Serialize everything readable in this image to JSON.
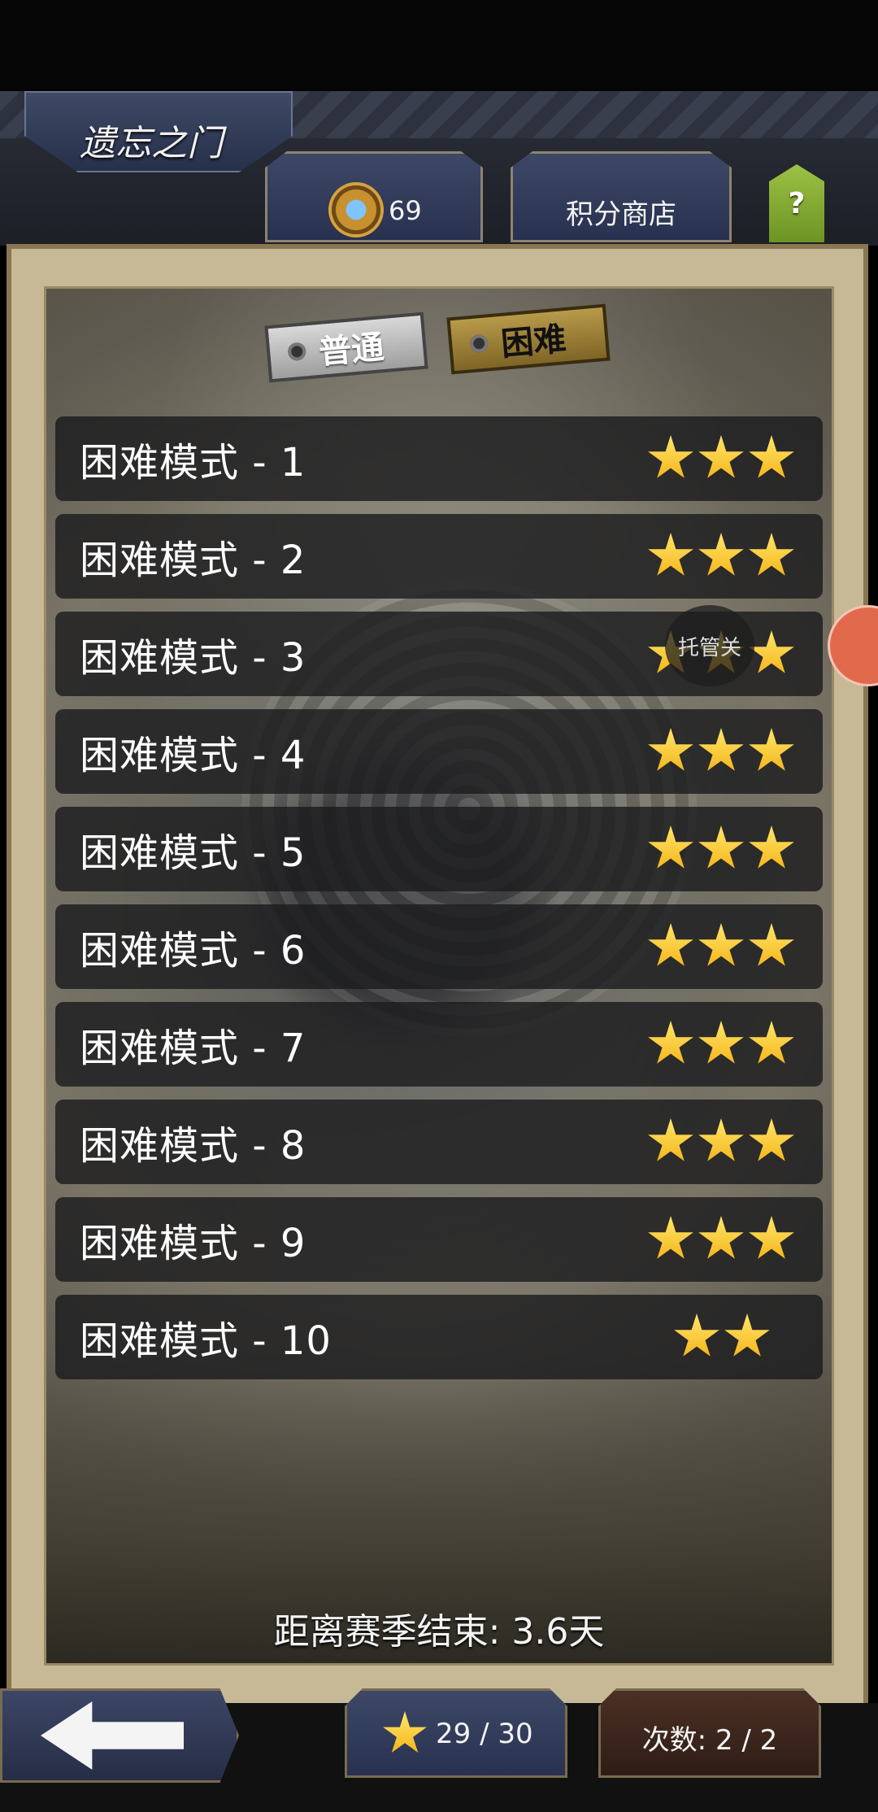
{
  "header": {
    "title": "遗忘之门"
  },
  "score": {
    "value": "69"
  },
  "shop": {
    "label": "积分商店"
  },
  "help": {
    "label": "?"
  },
  "difficulty_tabs": {
    "normal": "普通",
    "hard": "困难",
    "selected": "困难"
  },
  "overlay": {
    "auto_label": "托管关"
  },
  "levels": [
    {
      "label": "困难模式 - 1",
      "stars": 3
    },
    {
      "label": "困难模式 - 2",
      "stars": 3
    },
    {
      "label": "困难模式 - 3",
      "stars": 3
    },
    {
      "label": "困难模式 - 4",
      "stars": 3
    },
    {
      "label": "困难模式 - 5",
      "stars": 3
    },
    {
      "label": "困难模式 - 6",
      "stars": 3
    },
    {
      "label": "困难模式 - 7",
      "stars": 3
    },
    {
      "label": "困难模式 - 8",
      "stars": 3
    },
    {
      "label": "困难模式 - 9",
      "stars": 3
    },
    {
      "label": "困难模式 - 10",
      "stars": 2
    }
  ],
  "season": {
    "text": "距离赛季结束: 3.6天"
  },
  "footer": {
    "stars_text": "29 / 30",
    "count_text": "次数: 2 / 2"
  },
  "colors": {
    "star": "#f4b214",
    "row_bg": "#1c1c1e",
    "panel_frame": "#c7b896"
  }
}
